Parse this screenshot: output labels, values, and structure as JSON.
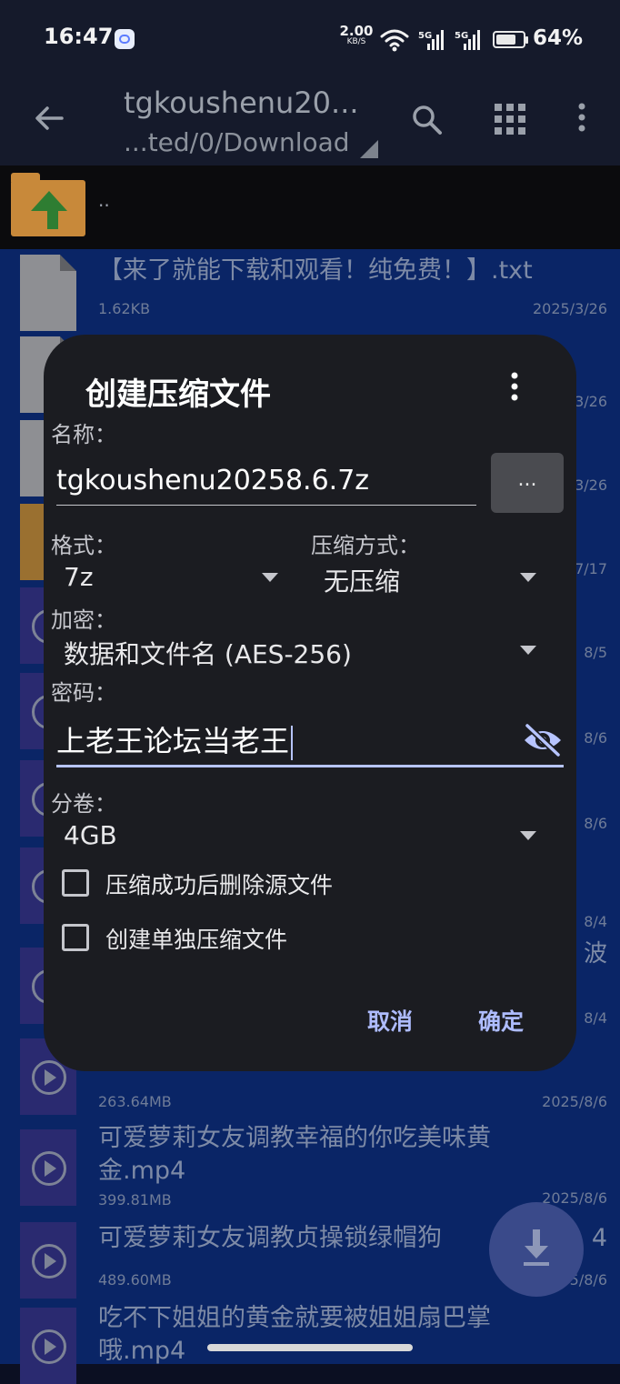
{
  "status_bar": {
    "time": "16:47",
    "net_speed_value": "2.00",
    "net_speed_unit": "KB/S",
    "signal1_label": "5G",
    "signal2_label": "5G",
    "battery_percent": "64%"
  },
  "toolbar": {
    "title": "tgkoushenu20...",
    "subtitle": "...ted/0/Download",
    "icons": [
      "back-arrow-icon",
      "search-icon",
      "grid-view-icon",
      "more-vert-icon"
    ]
  },
  "file_list": {
    "parent_label": "..",
    "items": [
      {
        "name": "【来了就能下载和观看！纯免费！】.txt",
        "size": "1.62KB",
        "date": "2025/3/26",
        "type": "doc"
      },
      {
        "date_partial": "3/26",
        "type": "doc"
      },
      {
        "date_partial": "3/26",
        "type": "doc"
      },
      {
        "date_partial": "7/17",
        "type": "archive"
      },
      {
        "date_partial": "8/5",
        "type": "video"
      },
      {
        "date_partial": "8/6",
        "type": "video"
      },
      {
        "date_partial": "8/6",
        "type": "video"
      },
      {
        "date_partial": "8/4",
        "type": "video"
      },
      {
        "date_partial": "8/4",
        "type": "video",
        "name_partial": "波"
      },
      {
        "size": "263.64MB",
        "date": "2025/8/6",
        "type": "video"
      },
      {
        "name": "可爱萝莉女友调教幸福的你吃美味黄金.mp4",
        "name_line1": "可爱萝莉女友调教幸福的你吃美味黄",
        "name_line2": "金.mp4",
        "size": "399.81MB",
        "date": "2025/8/6",
        "type": "video"
      },
      {
        "name": "可爱萝莉女友调教贞操锁绿帽狗男友.mp4",
        "name_visible": "可爱萝莉女友调教贞操锁绿帽狗",
        "name_tail": "4",
        "size": "489.60MB",
        "date_partial": "5/8/6",
        "type": "video"
      },
      {
        "name_line1": "吃不下姐姐的黄金就要被姐姐扇巴掌",
        "name_line2": "哦.mp4",
        "type": "video"
      }
    ]
  },
  "dialog": {
    "title": "创建压缩文件",
    "name_label": "名称：",
    "name_value": "tgkoushenu20258.6.7z",
    "browse_button": "...",
    "format_label": "格式：",
    "format_value": "7z",
    "compression_label": "压缩方式：",
    "compression_value": "无压缩",
    "encryption_label": "加密：",
    "encryption_value": "数据和文件名 (AES-256)",
    "password_label": "密码：",
    "password_value": "上老王论坛当老王",
    "split_label": "分卷：",
    "split_value": "4GB",
    "checkbox1_label": "压缩成功后删除源文件",
    "checkbox1_checked": false,
    "checkbox2_label": "创建单独压缩文件",
    "checkbox2_checked": false,
    "cancel_button": "取消",
    "ok_button": "确定"
  },
  "colors": {
    "accent": "#aebcff",
    "dialog_bg": "#1b1c21",
    "selection_bg": "#0a2566"
  }
}
